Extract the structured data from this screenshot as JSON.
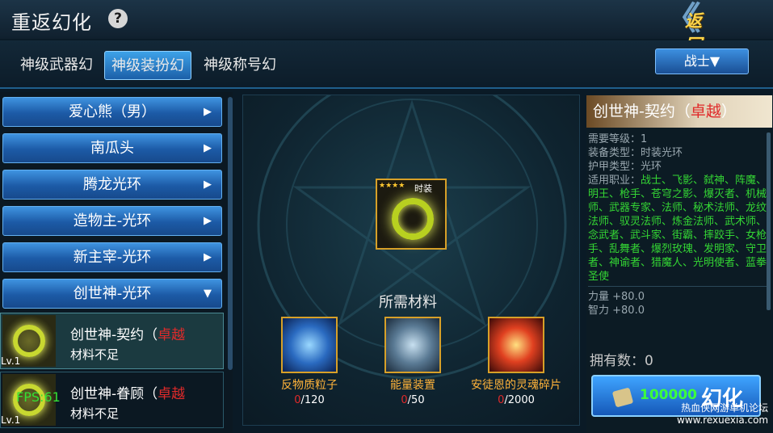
{
  "header": {
    "title": "重返幻化",
    "help_icon": "?",
    "back_label": "返回"
  },
  "tabs": [
    {
      "label": "神级武器幻",
      "active": false
    },
    {
      "label": "神级装扮幻",
      "active": true
    },
    {
      "label": "神级称号幻",
      "active": false
    }
  ],
  "class_select": {
    "value": "战士▼"
  },
  "categories": [
    {
      "label": "爱心熊（男）",
      "arrow": "▶"
    },
    {
      "label": "南瓜头",
      "arrow": "▶"
    },
    {
      "label": "腾龙光环",
      "arrow": "▶"
    },
    {
      "label": "造物主-光环",
      "arrow": "▶"
    },
    {
      "label": "新主宰-光环",
      "arrow": "▶"
    },
    {
      "label": "创世神-光环",
      "arrow": "▼"
    }
  ],
  "items": [
    {
      "name": "创世神-契约（",
      "rarity": "卓越",
      "status": "材料不足",
      "level": "Lv.1"
    },
    {
      "name": "创世神-眷顾（",
      "rarity": "卓越",
      "status": "材料不足",
      "level": "Lv.1"
    }
  ],
  "fps": "FPS:61",
  "center": {
    "item_tag": "时装",
    "stars": "★★★★",
    "required_label": "所需材料",
    "materials": [
      {
        "name": "反物质粒子",
        "have": "0",
        "need": "/120"
      },
      {
        "name": "能量装置",
        "have": "0",
        "need": "/50"
      },
      {
        "name": "安徒恩的灵魂碎片",
        "have": "0",
        "need": "/2000"
      }
    ]
  },
  "detail": {
    "title": "创世神-契约（",
    "rarity": "卓越",
    "close_paren": "）",
    "level_label": "需要等级：",
    "level_value": "1",
    "equip_type_label": "装备类型：",
    "equip_type_value": "时装光环",
    "armor_type_label": "护甲类型：",
    "armor_type_value": "光环",
    "jobs_label": "适用职业：",
    "jobs_value": "战士、飞影、弑神、阵魔、明王、枪手、苍穹之影、爆灭者、机械师、武器专家、法师、秘术法师、龙纹法师、驭灵法师、炼金法师、武术师、念武者、武斗家、街霸、摔跤手、女枪手、乱舞者、爆烈玫瑰、发明家、守卫者、神谕者、猎魔人、光明使者、蓝拳圣使",
    "stat1": "力量 +80.0",
    "stat2": "智力 +80.0",
    "own_label": "拥有数：",
    "own_value": "0",
    "cost": "100000",
    "fuse_label": "幻化"
  },
  "watermark": {
    "line1": "热血侠网游单机论坛",
    "line2": "www.rexuexia.com"
  },
  "colors": {
    "rare": "#e02a2a",
    "accent": "#3ea2e8",
    "gold_border": "#d7a028",
    "job_green": "#34d634"
  }
}
